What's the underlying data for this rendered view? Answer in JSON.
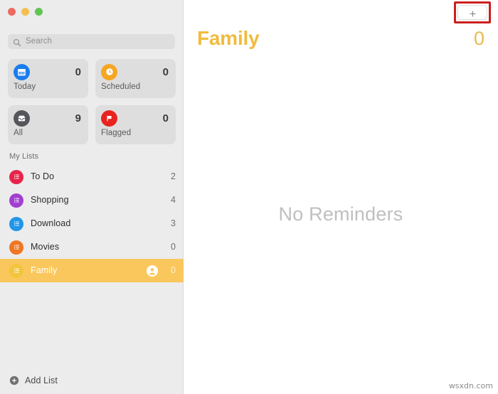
{
  "window": {
    "traffic_lights": [
      {
        "name": "close",
        "color": "#ed6a5e"
      },
      {
        "name": "minimize",
        "color": "#f5bf4f"
      },
      {
        "name": "maximize",
        "color": "#61c454"
      }
    ]
  },
  "sidebar": {
    "search": {
      "placeholder": "Search",
      "value": "",
      "icon": "search-icon"
    },
    "smart_lists": [
      {
        "label": "Today",
        "count": "0",
        "icon": "calendar-icon",
        "color": "#1b7ded"
      },
      {
        "label": "Scheduled",
        "count": "0",
        "icon": "clock-icon",
        "color": "#f5a623"
      },
      {
        "label": "All",
        "count": "9",
        "icon": "inbox-icon",
        "color": "#55555c"
      },
      {
        "label": "Flagged",
        "count": "0",
        "icon": "flag-icon",
        "color": "#e8231f"
      }
    ],
    "section_header": "My Lists",
    "lists": [
      {
        "label": "To Do",
        "count": "2",
        "icon": "list-icon",
        "color": "#e8234a",
        "selected": false,
        "shared": false
      },
      {
        "label": "Shopping",
        "count": "4",
        "icon": "list-icon",
        "color": "#a13fd1",
        "selected": false,
        "shared": false
      },
      {
        "label": "Download",
        "count": "3",
        "icon": "list-icon",
        "color": "#2196e8",
        "selected": false,
        "shared": false
      },
      {
        "label": "Movies",
        "count": "0",
        "icon": "list-icon",
        "color": "#ef7622",
        "selected": false,
        "shared": false
      },
      {
        "label": "Family",
        "count": "0",
        "icon": "list-icon",
        "color": "#f2c53c",
        "selected": true,
        "shared": true
      }
    ],
    "add_list": {
      "label": "Add List",
      "icon": "plus-circle-icon"
    }
  },
  "main": {
    "title": "Family",
    "count": "0",
    "empty_state": "No Reminders",
    "add_reminder": {
      "icon": "plus-icon",
      "label": "",
      "annotation_color": "#cc1f1f"
    }
  },
  "watermark": "wsxdn.com",
  "colors": {
    "accent": "#f0bc3e",
    "selection": "#fac75c",
    "sidebar_bg": "#ececec",
    "card_bg": "#dedede",
    "annotation": "#cc1f1f"
  }
}
